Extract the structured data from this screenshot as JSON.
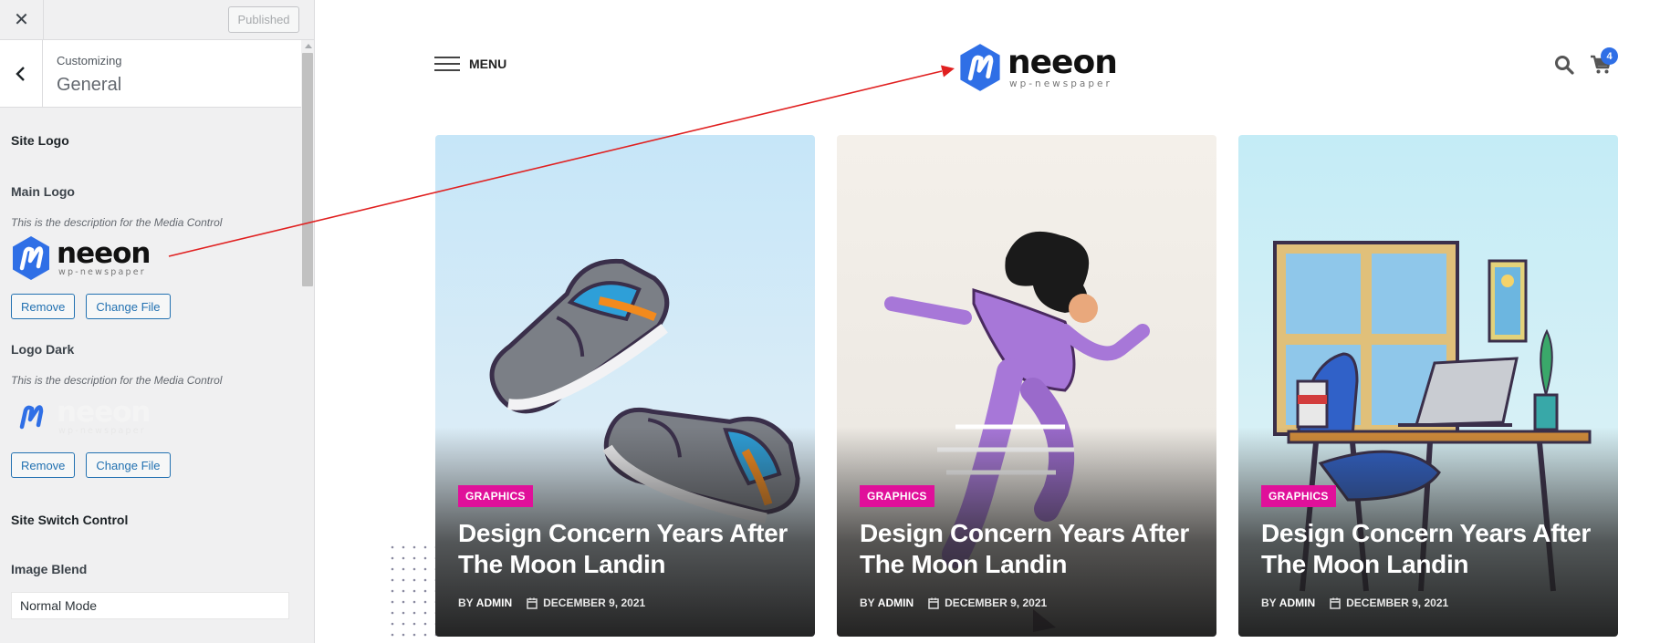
{
  "customizer": {
    "close_icon": "close-icon",
    "publish_label": "Published",
    "section_label": "Customizing",
    "section_title": "General",
    "site_logo_heading": "Site Logo",
    "main_logo": {
      "title": "Main Logo",
      "description": "This is the description for the Media Control",
      "remove_label": "Remove",
      "change_label": "Change File"
    },
    "logo_dark": {
      "title": "Logo Dark",
      "description": "This is the description for the Media Control",
      "remove_label": "Remove",
      "change_label": "Change File"
    },
    "switch_heading": "Site Switch Control",
    "image_blend": {
      "title": "Image Blend",
      "value": "Normal Mode"
    }
  },
  "logo": {
    "word": "neeon",
    "tagline": "wp-newspaper",
    "accent_color": "#2f6fe6"
  },
  "preview": {
    "menu_label": "MENU",
    "cart_count": "4",
    "cards": [
      {
        "category": "GRAPHICS",
        "title": "Design Concern Years After The Moon Landin",
        "by": "BY",
        "author": "ADMIN",
        "date": "DECEMBER 9, 2021"
      },
      {
        "category": "GRAPHICS",
        "title": "Design Concern Years After The Moon Landin",
        "by": "BY",
        "author": "ADMIN",
        "date": "DECEMBER 9, 2021"
      },
      {
        "category": "GRAPHICS",
        "title": "Design Concern Years After The Moon Landin",
        "by": "BY",
        "author": "ADMIN",
        "date": "DECEMBER 9, 2021"
      }
    ]
  },
  "colors": {
    "badge": "#e0109a",
    "wp_blue": "#2271b1",
    "annotation_arrow": "#e02020"
  }
}
